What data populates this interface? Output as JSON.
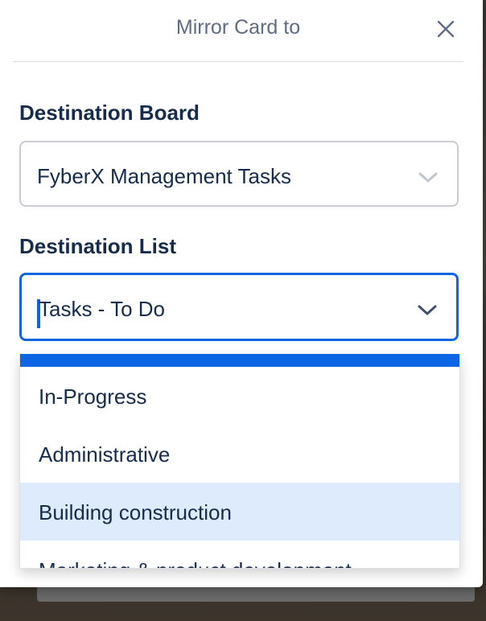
{
  "popover": {
    "title": "Mirror Card to"
  },
  "board_field": {
    "label": "Destination Board",
    "value": "FyberX Management Tasks"
  },
  "list_field": {
    "label": "Destination List",
    "value": "Tasks - To Do"
  },
  "dropdown": {
    "options": [
      {
        "label": "In-Progress",
        "highlighted": false
      },
      {
        "label": "Administrative",
        "highlighted": false
      },
      {
        "label": "Building construction",
        "highlighted": true
      },
      {
        "label": "Marketing & product development",
        "highlighted": false
      }
    ]
  },
  "colors": {
    "accent": "#0c66e4",
    "highlight": "#deebfc",
    "text": "#172b4d",
    "muted": "#5e6c84"
  },
  "icons": {
    "close": "close-icon",
    "chevron": "chevron-down-icon"
  }
}
